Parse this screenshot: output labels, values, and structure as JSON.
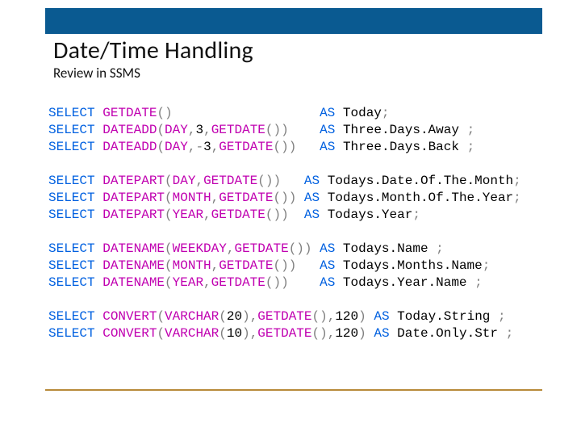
{
  "header": {
    "title": "Date/Time Handling",
    "subtitle": "Review in SSMS"
  },
  "code": {
    "lines": [
      {
        "indentSelect": "",
        "tokens": [
          {
            "c": "kw",
            "t": "SELECT "
          },
          {
            "c": "func",
            "t": "GETDATE"
          },
          {
            "c": "par",
            "t": "()"
          },
          {
            "c": "txt",
            "t": "                   "
          },
          {
            "c": "kw",
            "t": "AS "
          },
          {
            "c": "alias",
            "t": "Today"
          },
          {
            "c": "punc",
            "t": ";"
          }
        ]
      },
      {
        "tokens": [
          {
            "c": "kw",
            "t": "SELECT "
          },
          {
            "c": "func",
            "t": "DATEADD"
          },
          {
            "c": "par",
            "t": "("
          },
          {
            "c": "arg",
            "t": "DAY"
          },
          {
            "c": "punc",
            "t": ","
          },
          {
            "c": "num",
            "t": "3"
          },
          {
            "c": "punc",
            "t": ","
          },
          {
            "c": "func",
            "t": "GETDATE"
          },
          {
            "c": "par",
            "t": "())"
          },
          {
            "c": "txt",
            "t": "    "
          },
          {
            "c": "kw",
            "t": "AS "
          },
          {
            "c": "alias",
            "t": "Three.Days.Away "
          },
          {
            "c": "punc",
            "t": ";"
          }
        ]
      },
      {
        "tokens": [
          {
            "c": "kw",
            "t": "SELECT "
          },
          {
            "c": "func",
            "t": "DATEADD"
          },
          {
            "c": "par",
            "t": "("
          },
          {
            "c": "arg",
            "t": "DAY"
          },
          {
            "c": "punc",
            "t": ","
          },
          {
            "c": "neg",
            "t": "-"
          },
          {
            "c": "num",
            "t": "3"
          },
          {
            "c": "punc",
            "t": ","
          },
          {
            "c": "func",
            "t": "GETDATE"
          },
          {
            "c": "par",
            "t": "())"
          },
          {
            "c": "txt",
            "t": "   "
          },
          {
            "c": "kw",
            "t": "AS "
          },
          {
            "c": "alias",
            "t": "Three.Days.Back "
          },
          {
            "c": "punc",
            "t": ";"
          }
        ]
      },
      {
        "blank": true
      },
      {
        "tokens": [
          {
            "c": "kw",
            "t": "SELECT "
          },
          {
            "c": "func",
            "t": "DATEPART"
          },
          {
            "c": "par",
            "t": "("
          },
          {
            "c": "arg",
            "t": "DAY"
          },
          {
            "c": "punc",
            "t": ","
          },
          {
            "c": "func",
            "t": "GETDATE"
          },
          {
            "c": "par",
            "t": "())"
          },
          {
            "c": "txt",
            "t": "   "
          },
          {
            "c": "kw",
            "t": "AS "
          },
          {
            "c": "alias",
            "t": "Todays.Date.Of.The.Month"
          },
          {
            "c": "punc",
            "t": ";"
          }
        ]
      },
      {
        "tokens": [
          {
            "c": "kw",
            "t": "SELECT "
          },
          {
            "c": "func",
            "t": "DATEPART"
          },
          {
            "c": "par",
            "t": "("
          },
          {
            "c": "arg",
            "t": "MONTH"
          },
          {
            "c": "punc",
            "t": ","
          },
          {
            "c": "func",
            "t": "GETDATE"
          },
          {
            "c": "par",
            "t": "())"
          },
          {
            "c": "txt",
            "t": " "
          },
          {
            "c": "kw",
            "t": "AS "
          },
          {
            "c": "alias",
            "t": "Todays.Month.Of.The.Year"
          },
          {
            "c": "punc",
            "t": ";"
          }
        ]
      },
      {
        "tokens": [
          {
            "c": "kw",
            "t": "SELECT "
          },
          {
            "c": "func",
            "t": "DATEPART"
          },
          {
            "c": "par",
            "t": "("
          },
          {
            "c": "arg",
            "t": "YEAR"
          },
          {
            "c": "punc",
            "t": ","
          },
          {
            "c": "func",
            "t": "GETDATE"
          },
          {
            "c": "par",
            "t": "())"
          },
          {
            "c": "txt",
            "t": "  "
          },
          {
            "c": "kw",
            "t": "AS "
          },
          {
            "c": "alias",
            "t": "Todays.Year"
          },
          {
            "c": "punc",
            "t": ";"
          }
        ]
      },
      {
        "blank": true
      },
      {
        "tokens": [
          {
            "c": "kw",
            "t": "SELECT "
          },
          {
            "c": "func",
            "t": "DATENAME"
          },
          {
            "c": "par",
            "t": "("
          },
          {
            "c": "arg",
            "t": "WEEKDAY"
          },
          {
            "c": "punc",
            "t": ","
          },
          {
            "c": "func",
            "t": "GETDATE"
          },
          {
            "c": "par",
            "t": "())"
          },
          {
            "c": "txt",
            "t": " "
          },
          {
            "c": "kw",
            "t": "AS "
          },
          {
            "c": "alias",
            "t": "Todays.Name "
          },
          {
            "c": "punc",
            "t": ";"
          }
        ]
      },
      {
        "tokens": [
          {
            "c": "kw",
            "t": "SELECT "
          },
          {
            "c": "func",
            "t": "DATENAME"
          },
          {
            "c": "par",
            "t": "("
          },
          {
            "c": "arg",
            "t": "MONTH"
          },
          {
            "c": "punc",
            "t": ","
          },
          {
            "c": "func",
            "t": "GETDATE"
          },
          {
            "c": "par",
            "t": "())"
          },
          {
            "c": "txt",
            "t": "   "
          },
          {
            "c": "kw",
            "t": "AS "
          },
          {
            "c": "alias",
            "t": "Todays.Months.Name"
          },
          {
            "c": "punc",
            "t": ";"
          }
        ]
      },
      {
        "tokens": [
          {
            "c": "kw",
            "t": "SELECT "
          },
          {
            "c": "func",
            "t": "DATENAME"
          },
          {
            "c": "par",
            "t": "("
          },
          {
            "c": "arg",
            "t": "YEAR"
          },
          {
            "c": "punc",
            "t": ","
          },
          {
            "c": "func",
            "t": "GETDATE"
          },
          {
            "c": "par",
            "t": "())"
          },
          {
            "c": "txt",
            "t": "    "
          },
          {
            "c": "kw",
            "t": "AS "
          },
          {
            "c": "alias",
            "t": "Todays.Year.Name "
          },
          {
            "c": "punc",
            "t": ";"
          }
        ]
      },
      {
        "blank": true
      },
      {
        "tokens": [
          {
            "c": "kw",
            "t": "SELECT "
          },
          {
            "c": "func",
            "t": "CONVERT"
          },
          {
            "c": "par",
            "t": "("
          },
          {
            "c": "arg",
            "t": "VARCHAR"
          },
          {
            "c": "par",
            "t": "("
          },
          {
            "c": "num",
            "t": "20"
          },
          {
            "c": "par",
            "t": ")"
          },
          {
            "c": "punc",
            "t": ","
          },
          {
            "c": "func",
            "t": "GETDATE"
          },
          {
            "c": "par",
            "t": "()"
          },
          {
            "c": "punc",
            "t": ","
          },
          {
            "c": "num",
            "t": "120"
          },
          {
            "c": "par",
            "t": ")"
          },
          {
            "c": "txt",
            "t": " "
          },
          {
            "c": "kw",
            "t": "AS "
          },
          {
            "c": "alias",
            "t": "Today.String "
          },
          {
            "c": "punc",
            "t": ";"
          }
        ]
      },
      {
        "tokens": [
          {
            "c": "kw",
            "t": "SELECT "
          },
          {
            "c": "func",
            "t": "CONVERT"
          },
          {
            "c": "par",
            "t": "("
          },
          {
            "c": "arg",
            "t": "VARCHAR"
          },
          {
            "c": "par",
            "t": "("
          },
          {
            "c": "num",
            "t": "10"
          },
          {
            "c": "par",
            "t": ")"
          },
          {
            "c": "punc",
            "t": ","
          },
          {
            "c": "func",
            "t": "GETDATE"
          },
          {
            "c": "par",
            "t": "()"
          },
          {
            "c": "punc",
            "t": ","
          },
          {
            "c": "num",
            "t": "120"
          },
          {
            "c": "par",
            "t": ")"
          },
          {
            "c": "txt",
            "t": " "
          },
          {
            "c": "kw",
            "t": "AS "
          },
          {
            "c": "alias",
            "t": "Date.Only.Str "
          },
          {
            "c": "punc",
            "t": ";"
          }
        ]
      }
    ]
  }
}
